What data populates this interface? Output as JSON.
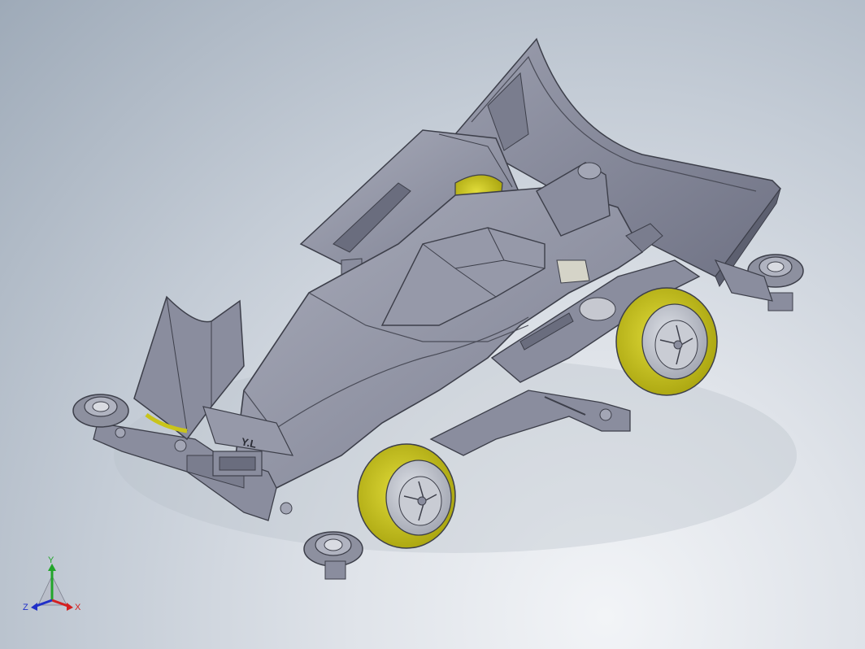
{
  "viewport": {
    "background_top": "#9eaab8",
    "background_bottom": "#f2f4f7"
  },
  "model": {
    "body_color": "#8a8d9e",
    "body_light": "#a3a6b5",
    "body_dark": "#5d6070",
    "tire_color": "#c9c41a",
    "wheel_color": "#b9bcc6",
    "badge_text": "Y.L"
  },
  "triad": {
    "x_label": "X",
    "y_label": "Y",
    "z_label": "Z",
    "x_color": "#d42020",
    "y_color": "#22a52a",
    "z_color": "#2030c8"
  }
}
